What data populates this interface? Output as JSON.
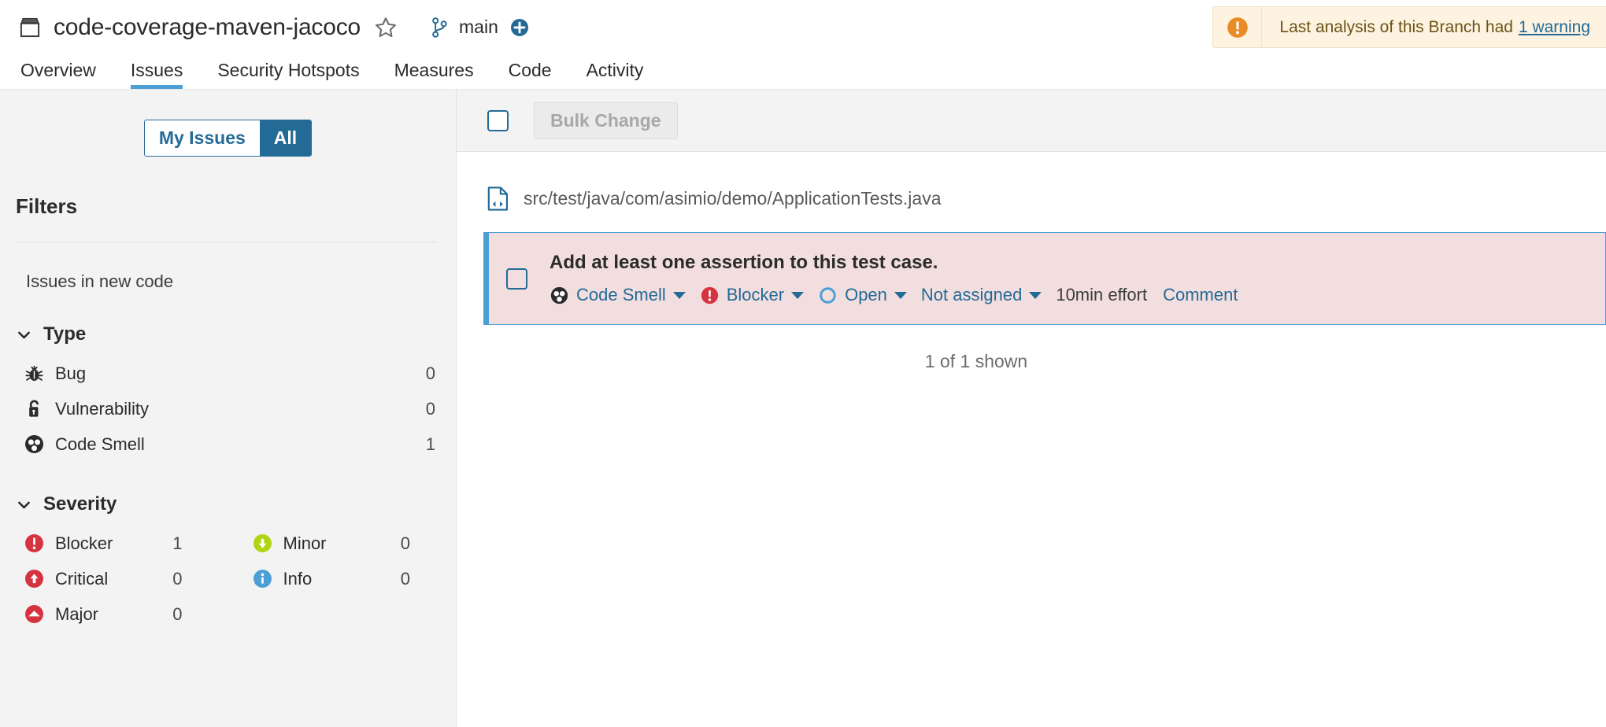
{
  "header": {
    "project_icon": "archive-box-icon",
    "project_name": "code-coverage-maven-jacoco",
    "favorite_icon": "star-outline-icon",
    "branch_icon": "branch-icon",
    "branch_name": "main",
    "add_icon": "plus-circle-icon",
    "warning": {
      "icon": "warning-exclamation-icon",
      "text": "Last analysis of this Branch had",
      "link": "1 warning",
      "bg_color": "#fdf3e0",
      "icon_color": "#e98c27",
      "text_color": "#6d5215"
    }
  },
  "nav": {
    "tabs": [
      {
        "label": "Overview",
        "active": false
      },
      {
        "label": "Issues",
        "active": true
      },
      {
        "label": "Security Hotspots",
        "active": false
      },
      {
        "label": "Measures",
        "active": false
      },
      {
        "label": "Code",
        "active": false
      },
      {
        "label": "Activity",
        "active": false
      }
    ],
    "active_underline_color": "#4b9fd5"
  },
  "sidebar": {
    "toggle": {
      "my_issues_label": "My Issues",
      "all_label": "All",
      "selected": "All",
      "accent_color": "#236a97"
    },
    "filters_title": "Filters",
    "new_code_label": "Issues in new code",
    "facets": [
      {
        "title": "Type",
        "expanded": true,
        "items": [
          {
            "icon": "bug-icon",
            "label": "Bug",
            "count": "0",
            "color": "#2b2b2b"
          },
          {
            "icon": "lock-icon",
            "label": "Vulnerability",
            "count": "0",
            "color": "#2b2b2b"
          },
          {
            "icon": "code-smell-icon",
            "label": "Code Smell",
            "count": "1",
            "color": "#2b2b2b"
          }
        ]
      },
      {
        "title": "Severity",
        "expanded": true,
        "items": [
          {
            "icon": "severity-blocker-icon",
            "label": "Blocker",
            "count": "1",
            "color": "#d4333f"
          },
          {
            "icon": "severity-minor-icon",
            "label": "Minor",
            "count": "0",
            "color": "#b0d513"
          },
          {
            "icon": "severity-critical-icon",
            "label": "Critical",
            "count": "0",
            "color": "#d4333f"
          },
          {
            "icon": "severity-info-icon",
            "label": "Info",
            "count": "0",
            "color": "#4b9fd5"
          },
          {
            "icon": "severity-major-icon",
            "label": "Major",
            "count": "0",
            "color": "#d4333f"
          }
        ]
      }
    ]
  },
  "main": {
    "toolbar": {
      "select_all_checkbox": "unchecked",
      "bulk_change_label": "Bulk Change",
      "bulk_change_disabled": true
    },
    "file": {
      "icon": "source-file-icon",
      "path": "src/test/java/com/asimio/demo/ApplicationTests.java"
    },
    "issue": {
      "checkbox": "unchecked",
      "message": "Add at least one assertion to this test case.",
      "type": {
        "icon": "code-smell-icon",
        "label": "Code Smell",
        "has_caret": true
      },
      "severity": {
        "icon": "severity-blocker-icon",
        "label": "Blocker",
        "has_caret": true
      },
      "status": {
        "icon": "status-open-icon",
        "label": "Open",
        "has_caret": true
      },
      "assignee": {
        "label": "Not assigned",
        "has_caret": true
      },
      "effort": "10min effort",
      "comment_label": "Comment",
      "bg_color": "#f2dede",
      "border_color": "#4b9fd5"
    },
    "shown_count": "1 of 1 shown"
  }
}
